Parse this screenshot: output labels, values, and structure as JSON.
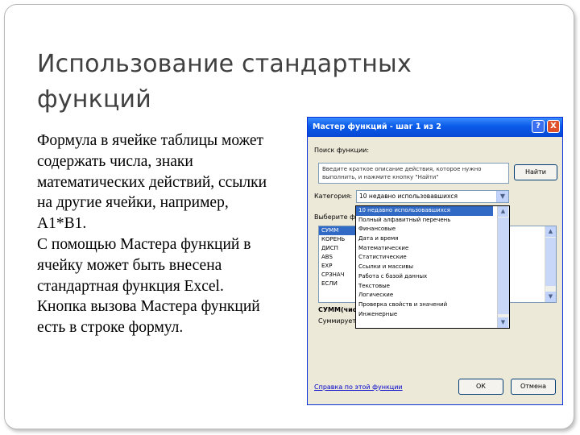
{
  "slide": {
    "title": "Использование стандартных функций",
    "body": [
      "Формула в ячейке таблицы может содержать числа, знаки математических действий, ссылки на другие ячейки, например, А1*В1.",
      "С помощью Мастера функций в ячейку может быть внесена стандартная функция Excel.",
      "Кнопка вызова Мастера функций есть в строке формул."
    ]
  },
  "dialog": {
    "title": "Мастер функций - шаг 1 из 2",
    "help_button": "?",
    "close_button": "X",
    "search_label": "Поиск функции:",
    "search_text": "Введите краткое описание действия, которое нужно выполнить, и нажмите кнопку \"Найти\"",
    "find_button": "Найти",
    "category_label": "Категория:",
    "category_value": "10 недавно использовавшихся",
    "select_label": "Выберите фу",
    "functions": [
      "СУММ",
      "КОРЕНЬ",
      "ДИСП",
      "ABS",
      "EXP",
      "СРЗНАЧ",
      "ЕСЛИ"
    ],
    "categories": [
      "10 недавно использовавшихся",
      "Полный алфавитный перечень",
      "Финансовые",
      "Дата и время",
      "Математические",
      "Статистические",
      "Ссылки и массивы",
      "Работа с базой данных",
      "Текстовые",
      "Логические",
      "Проверка свойств и значений",
      "Инженерные"
    ],
    "syntax_label": "СУММ(чис",
    "desc_label": "Суммирует а",
    "help_link": "Справка по этой функции",
    "ok_button": "ОК",
    "cancel_button": "Отмена"
  },
  "colors": {
    "title_text": "#404040",
    "dialog_bg": "#ece9d8",
    "selection": "#316ac5",
    "titlebar": "#0a5be8"
  }
}
